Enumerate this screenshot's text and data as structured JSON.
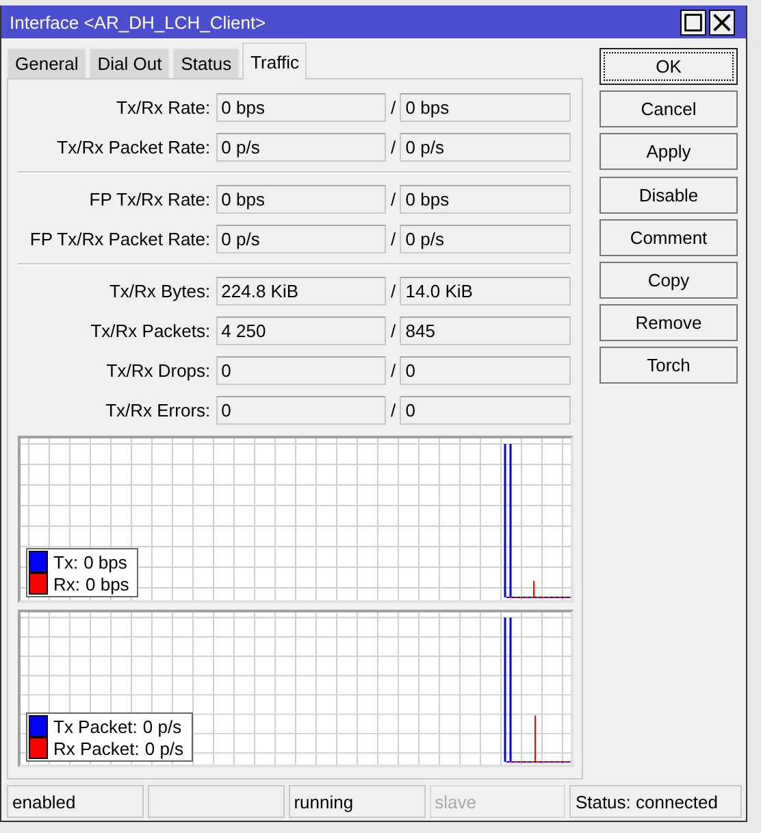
{
  "window": {
    "title": "Interface <AR_DH_LCH_Client>"
  },
  "tabs": [
    {
      "label": "General",
      "selected": false
    },
    {
      "label": "Dial Out",
      "selected": false
    },
    {
      "label": "Status",
      "selected": false
    },
    {
      "label": "Traffic",
      "selected": true
    }
  ],
  "sections": [
    [
      {
        "label": "Tx/Rx Rate:",
        "tx": "0 bps",
        "separator": "/",
        "rx": "0 bps"
      },
      {
        "label": "Tx/Rx Packet Rate:",
        "tx": "0 p/s",
        "separator": "/",
        "rx": "0 p/s"
      }
    ],
    [
      {
        "label": "FP Tx/Rx Rate:",
        "tx": "0 bps",
        "separator": "/",
        "rx": "0 bps"
      },
      {
        "label": "FP Tx/Rx Packet Rate:",
        "tx": "0 p/s",
        "separator": "/",
        "rx": "0 p/s"
      }
    ],
    [
      {
        "label": "Tx/Rx Bytes:",
        "tx": "224.8 KiB",
        "separator": "/",
        "rx": "14.0 KiB"
      },
      {
        "label": "Tx/Rx Packets:",
        "tx": "4 250",
        "separator": "/",
        "rx": "845"
      },
      {
        "label": "Tx/Rx Drops:",
        "tx": "0",
        "separator": "/",
        "rx": "0"
      },
      {
        "label": "Tx/Rx Errors:",
        "tx": "0",
        "separator": "/",
        "rx": "0"
      }
    ]
  ],
  "graphs": [
    {
      "legend": [
        {
          "label": "Tx:",
          "value": "0 bps",
          "color": "#0000ff"
        },
        {
          "label": "Rx:",
          "value": "0 bps",
          "color": "#ff0000"
        }
      ]
    },
    {
      "legend": [
        {
          "label": "Tx Packet:",
          "value": "0 p/s",
          "color": "#0000ff"
        },
        {
          "label": "Rx Packet:",
          "value": "0 p/s",
          "color": "#ff0000"
        }
      ]
    }
  ],
  "buttons": [
    [
      {
        "label": "OK",
        "focused": true
      },
      {
        "label": "Cancel",
        "focused": false
      },
      {
        "label": "Apply",
        "focused": false
      }
    ],
    [
      {
        "label": "Disable",
        "focused": false
      },
      {
        "label": "Comment",
        "focused": false
      },
      {
        "label": "Copy",
        "focused": false
      },
      {
        "label": "Remove",
        "focused": false
      },
      {
        "label": "Torch",
        "focused": false
      }
    ]
  ],
  "status_bar": [
    {
      "text": "enabled",
      "disabled": false
    },
    {
      "disabled": false
    },
    {
      "text": "running",
      "disabled": false
    },
    {
      "text": "slave",
      "disabled": true
    },
    {
      "text": "Status: connected",
      "disabled": false
    }
  ]
}
